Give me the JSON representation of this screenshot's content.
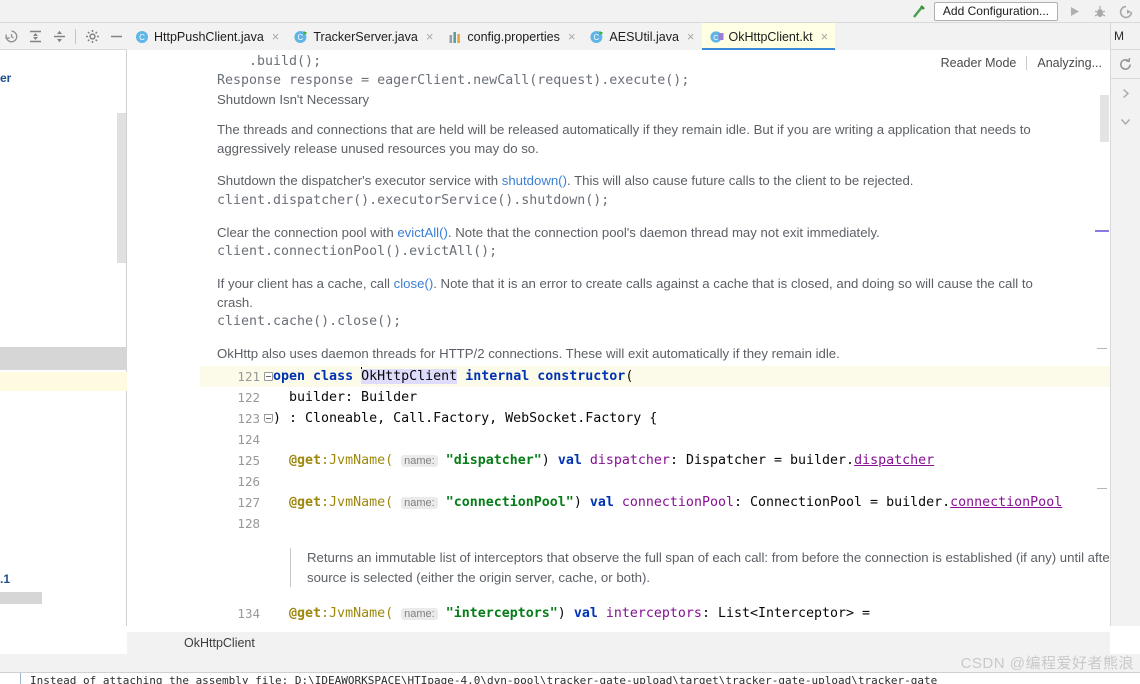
{
  "toolbar": {
    "build_icon": "hammer-icon",
    "add_configuration": "Add Configuration...",
    "run_icon": "run-play-icon",
    "debug_icon": "debug-bug-icon",
    "coverage_icon": "run-coverage-icon"
  },
  "left_tools": [
    {
      "name": "history-icon",
      "glyph": "history"
    },
    {
      "name": "expand-all-icon",
      "glyph": "expand"
    },
    {
      "name": "collapse-all-icon",
      "glyph": "collapse"
    },
    {
      "name": "settings-gear-icon",
      "glyph": "gear"
    },
    {
      "name": "hide-window-icon",
      "glyph": "minus"
    }
  ],
  "tabs": [
    {
      "label": "HttpPushClient.java",
      "icon": "java-class-icon",
      "active": false
    },
    {
      "label": "TrackerServer.java",
      "icon": "java-runnable-class-icon",
      "active": false
    },
    {
      "label": "config.properties",
      "icon": "properties-file-icon",
      "active": false
    },
    {
      "label": "AESUtil.java",
      "icon": "java-runnable-class-icon",
      "active": false
    },
    {
      "label": "OkHttpClient.kt",
      "icon": "kotlin-class-icon",
      "active": true
    }
  ],
  "tab_close_glyph": "×",
  "editor_header": {
    "reader_mode": "Reader Mode",
    "analyzing": "Analyzing..."
  },
  "left_pane": {
    "partial_label_top": "er",
    "partial_label_bottom": ".1"
  },
  "right_rail": {
    "tab_label": "M",
    "refresh_icon": "refresh-icon",
    "expand_icon": "chevron-right-icon",
    "collapse_icon": "chevron-down-icon"
  },
  "doc": {
    "snippet_build": "    .build();",
    "snippet_response": "Response response = eagerClient.newCall(request).execute();",
    "heading_shutdown": "Shutdown Isn't Necessary",
    "para_threads": "The threads and connections that are held will be released automatically if they remain idle. But if you are writing a application that needs to aggressively release unused resources you may do so.",
    "para_dispatcher_pre": "Shutdown the dispatcher's executor service with ",
    "para_dispatcher_link": "shutdown()",
    "para_dispatcher_post": ". This will also cause future calls to the client to be rejected.",
    "snippet_dispatcher": "client.dispatcher().executorService().shutdown();",
    "para_pool_pre": "Clear the connection pool with ",
    "para_pool_link": "evictAll()",
    "para_pool_post": ". Note that the connection pool's daemon thread may not exit immediately.",
    "snippet_pool": "client.connectionPool().evictAll();",
    "para_cache_pre": "If your client has a cache, call ",
    "para_cache_link": "close()",
    "para_cache_post": ". Note that it is an error to create calls against a cache that is closed, and doing so will cause the call to crash.",
    "snippet_cache": "client.cache().close();",
    "para_daemon": "OkHttp also uses daemon threads for HTTP/2 connections. These will exit automatically if they remain idle."
  },
  "code": {
    "lines": [
      {
        "num": "121",
        "highlight": true
      },
      {
        "num": "122",
        "highlight": false
      },
      {
        "num": "123",
        "highlight": false
      },
      {
        "num": "124",
        "highlight": false
      },
      {
        "num": "125",
        "highlight": false
      },
      {
        "num": "126",
        "highlight": false
      },
      {
        "num": "127",
        "highlight": false
      },
      {
        "num": "128",
        "highlight": false
      },
      {
        "num": "134",
        "highlight": false
      }
    ],
    "l121": {
      "kw_open": "open",
      "kw_class": "class",
      "name": "OkHttpClient",
      "kw_internal": "internal",
      "kw_constructor": "constructor",
      "paren": "("
    },
    "l122": "  builder: Builder",
    "l123": ") : Cloneable, Call.Factory, WebSocket.Factory {",
    "l125": {
      "annotation": "@get",
      "jvmname": ":JvmName(",
      "hint": "name:",
      "str": "\"dispatcher\"",
      "close": ")",
      "kw_val": "val",
      "prop": "dispatcher",
      "type": ": Dispatcher = builder.",
      "ref": "dispatcher"
    },
    "l127": {
      "annotation": "@get",
      "jvmname": ":JvmName(",
      "hint": "name:",
      "str": "\"connectionPool\"",
      "close": ")",
      "kw_val": "val",
      "prop": "connectionPool",
      "type": ": ConnectionPool = builder.",
      "ref": "connectionPool"
    },
    "l134": {
      "annotation": "@get",
      "jvmname": ":JvmName(",
      "hint": "name:",
      "str": "\"interceptors\"",
      "close": ")",
      "kw_val": "val",
      "prop": "interceptors",
      "type": ": List<Interceptor> ="
    },
    "inline_doc": "Returns an immutable list of interceptors that observe the full span of each call: from before the connection is established (if any) until after the response source is selected (either the origin server, cache, or both)."
  },
  "breadcrumb": {
    "label": "OkHttpClient"
  },
  "watermark": "CSDN @编程爱好者熊浪",
  "console": {
    "line": "Instead of attaching the assembly file: D:\\IDEAWORKSPACE\\HTIpage-4.0\\dyn-pool\\tracker-gate-upload\\target\\tracker-gate-upload\\tracker-gate"
  },
  "colors": {
    "accent_blue": "#3b8ad9",
    "active_tab_bg": "#ffffe4",
    "keyword": "#0033b3",
    "string": "#067d17",
    "property": "#871094",
    "annotation": "#9e880d",
    "doc_text": "#5c6066",
    "link": "#3a7fd5",
    "highlight_line": "#fcfae8"
  }
}
